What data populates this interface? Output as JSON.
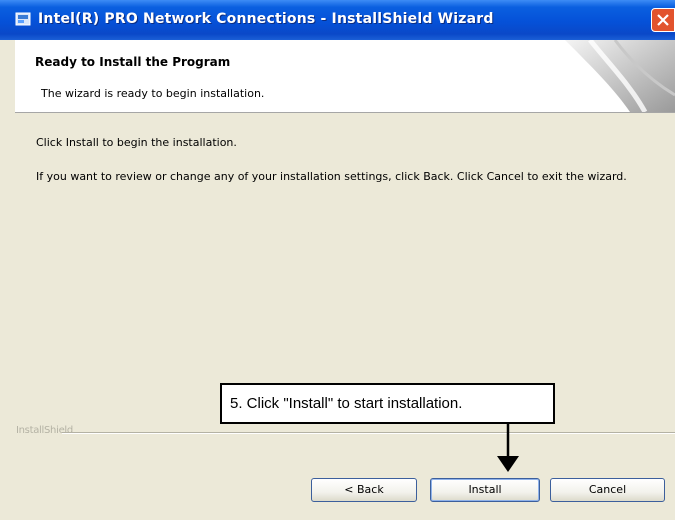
{
  "window": {
    "title": "Intel(R) PRO Network Connections - InstallShield Wizard"
  },
  "header": {
    "title": "Ready to Install the Program",
    "subtitle": "The wizard is ready to begin installation."
  },
  "content": {
    "line1": "Click Install to begin the installation.",
    "line2": "If you want to review or change any of your installation settings, click Back. Click Cancel to exit the wizard."
  },
  "footer": {
    "brand": "InstallShield"
  },
  "buttons": {
    "back": "< Back",
    "install": "Install",
    "cancel": "Cancel"
  },
  "annotation": {
    "callout": "5.   Click \"Install\" to start installation."
  },
  "colors": {
    "titlebar": "#0551d8",
    "dialog_bg": "#ece9d8",
    "close": "#e2532d"
  }
}
